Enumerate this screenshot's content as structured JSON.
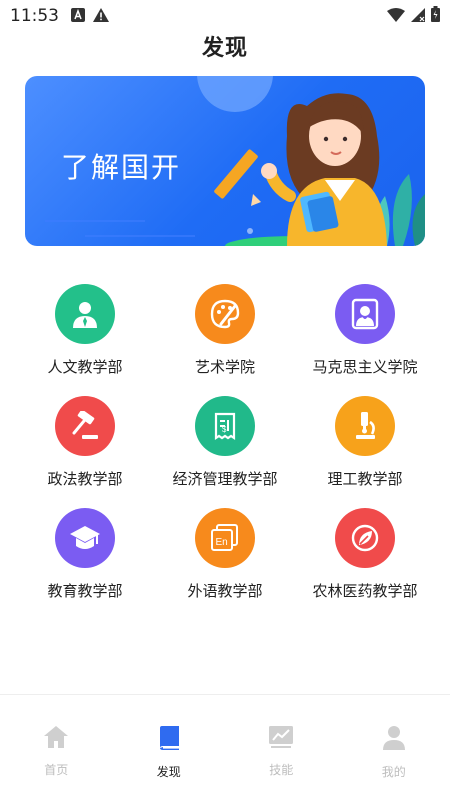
{
  "status_bar": {
    "time": "11:53",
    "icons": [
      "notification-a-icon",
      "warning-icon",
      "wifi-icon",
      "signal-icon",
      "battery-icon"
    ]
  },
  "header": {
    "title": "发现"
  },
  "banner": {
    "text": "了解国开",
    "colors": {
      "bg": "#1f6cf5",
      "circle": "#6fa6ff",
      "hair": "#6b3b22",
      "jacket": "#f7b62c"
    }
  },
  "categories": [
    {
      "label": "人文教学部",
      "color": "#23c08a",
      "icon": "person-icon"
    },
    {
      "label": "艺术学院",
      "color": "#f78a1c",
      "icon": "palette-icon"
    },
    {
      "label": "马克思主义学院",
      "color": "#7b5cf2",
      "icon": "portrait-icon"
    },
    {
      "label": "政法教学部",
      "color": "#f04b4b",
      "icon": "gavel-icon"
    },
    {
      "label": "经济管理教学部",
      "color": "#21b98a",
      "icon": "receipt-icon"
    },
    {
      "label": "理工教学部",
      "color": "#f7a21b",
      "icon": "microscope-icon"
    },
    {
      "label": "教育教学部",
      "color": "#7b5cf2",
      "icon": "graduation-cap-icon"
    },
    {
      "label": "外语教学部",
      "color": "#f78a1c",
      "icon": "english-book-icon"
    },
    {
      "label": "农林医药教学部",
      "color": "#f04b4b",
      "icon": "leaf-icon"
    }
  ],
  "tab_bar": {
    "tabs": [
      {
        "label": "首页",
        "icon": "home-icon",
        "active": false
      },
      {
        "label": "发现",
        "icon": "book-icon",
        "active": true
      },
      {
        "label": "技能",
        "icon": "chart-icon",
        "active": false
      },
      {
        "label": "我的",
        "icon": "user-icon",
        "active": false
      }
    ],
    "colors": {
      "active": "#2f6bf0",
      "inactive": "#cfcfcf"
    }
  }
}
